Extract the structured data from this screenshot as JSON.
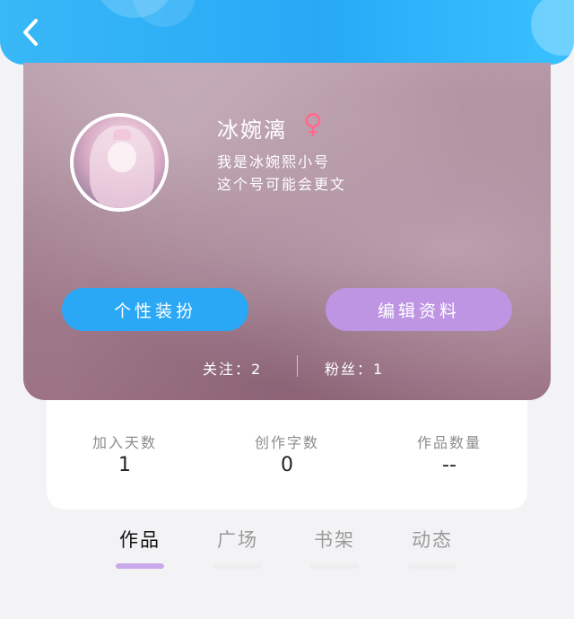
{
  "header": {
    "back_icon": "chevron-left-icon",
    "background_color": "#2aa8f6"
  },
  "profile": {
    "name": "冰婉漓",
    "gender_icon": "female-icon",
    "gender_symbol": "♀",
    "gender_color": "#ff6a8e",
    "bio_line1": "我是冰婉熙小号",
    "bio_line2": "这个号可能会更文",
    "dress_button_label": "个性装扮",
    "edit_button_label": "编辑资料",
    "following_text": "关注：2",
    "fans_text": "粉丝：1",
    "dress_button_color": "#2aa8f6",
    "edit_button_color": "#be95e3"
  },
  "stats": [
    {
      "label": "加入天数",
      "value": "1"
    },
    {
      "label": "创作字数",
      "value": "0"
    },
    {
      "label": "作品数量",
      "value": "--"
    }
  ],
  "tabs": [
    {
      "label": "作品",
      "active": true
    },
    {
      "label": "广场",
      "active": false
    },
    {
      "label": "书架",
      "active": false
    },
    {
      "label": "动态",
      "active": false
    }
  ],
  "accent_colors": {
    "active_tab_underline": "#c9a9ea"
  }
}
